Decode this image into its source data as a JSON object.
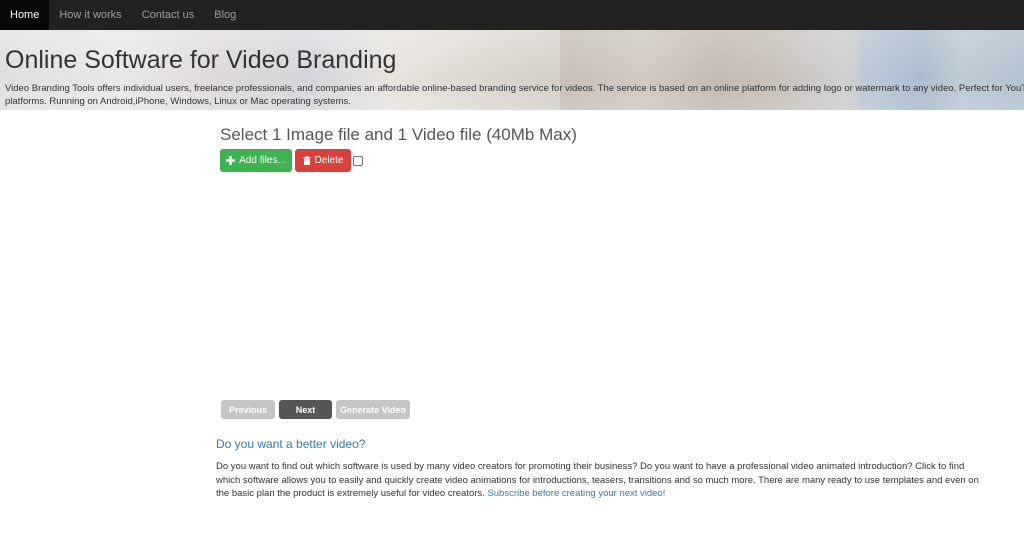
{
  "navbar": {
    "items": [
      {
        "label": "Home",
        "active": true
      },
      {
        "label": "How it works",
        "active": false
      },
      {
        "label": "Contact us",
        "active": false
      },
      {
        "label": "Blog",
        "active": false
      }
    ]
  },
  "hero": {
    "title": "Online Software for Video Branding",
    "description": "Video Branding Tools offers individual users, freelance professionals, and companies an affordable online-based branding service for videos. The service is based on an online platform for adding logo or watermark to any video. Perfect for YouTube platforms. Running on Android,iPhone, Windows, Linux or Mac operating systems."
  },
  "upload": {
    "title": "Select 1 Image file and 1 Video file (40Mb Max)",
    "add_files_label": "Add files...",
    "add_icon": "plus-icon",
    "delete_label": "Delete",
    "delete_icon": "trash-icon",
    "select_all_checked": false
  },
  "wizard": {
    "previous_label": "Previous",
    "next_label": "Next",
    "generate_label": "Generate Video"
  },
  "promo": {
    "heading": "Do you want a better video?",
    "text": "Do you want to find out which software is used by many video creators for promoting their business? Do you want to have a professional video animated introduction? Click to find which software allows you to easily and quickly create video animations for introductions, teasers, transitions and so much more. There are many ready to use templates and even on the basic plan the product is extremely useful for video creators. ",
    "link_text": "Subscribe before creating your next video!"
  },
  "colors": {
    "navbar_bg": "#222222",
    "add_button": "#3fb34f",
    "delete_button": "#d9413a",
    "next_button": "#555555",
    "disabled_button": "#c5c5c5",
    "link": "#337ab7"
  }
}
